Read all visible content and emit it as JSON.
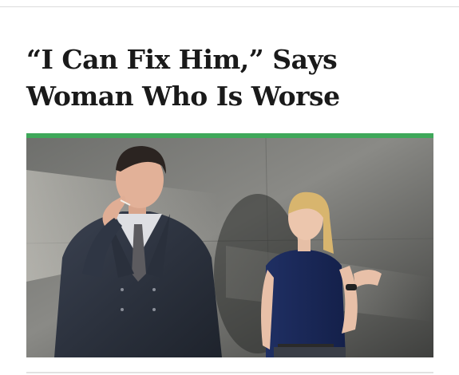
{
  "article": {
    "headline_line1": "“I Can Fix Him,” Says",
    "headline_line2": "Woman Who Is Worse",
    "accent_color": "#3fa85a",
    "photo_icon": "photo-man-and-woman-against-concrete-wall"
  }
}
